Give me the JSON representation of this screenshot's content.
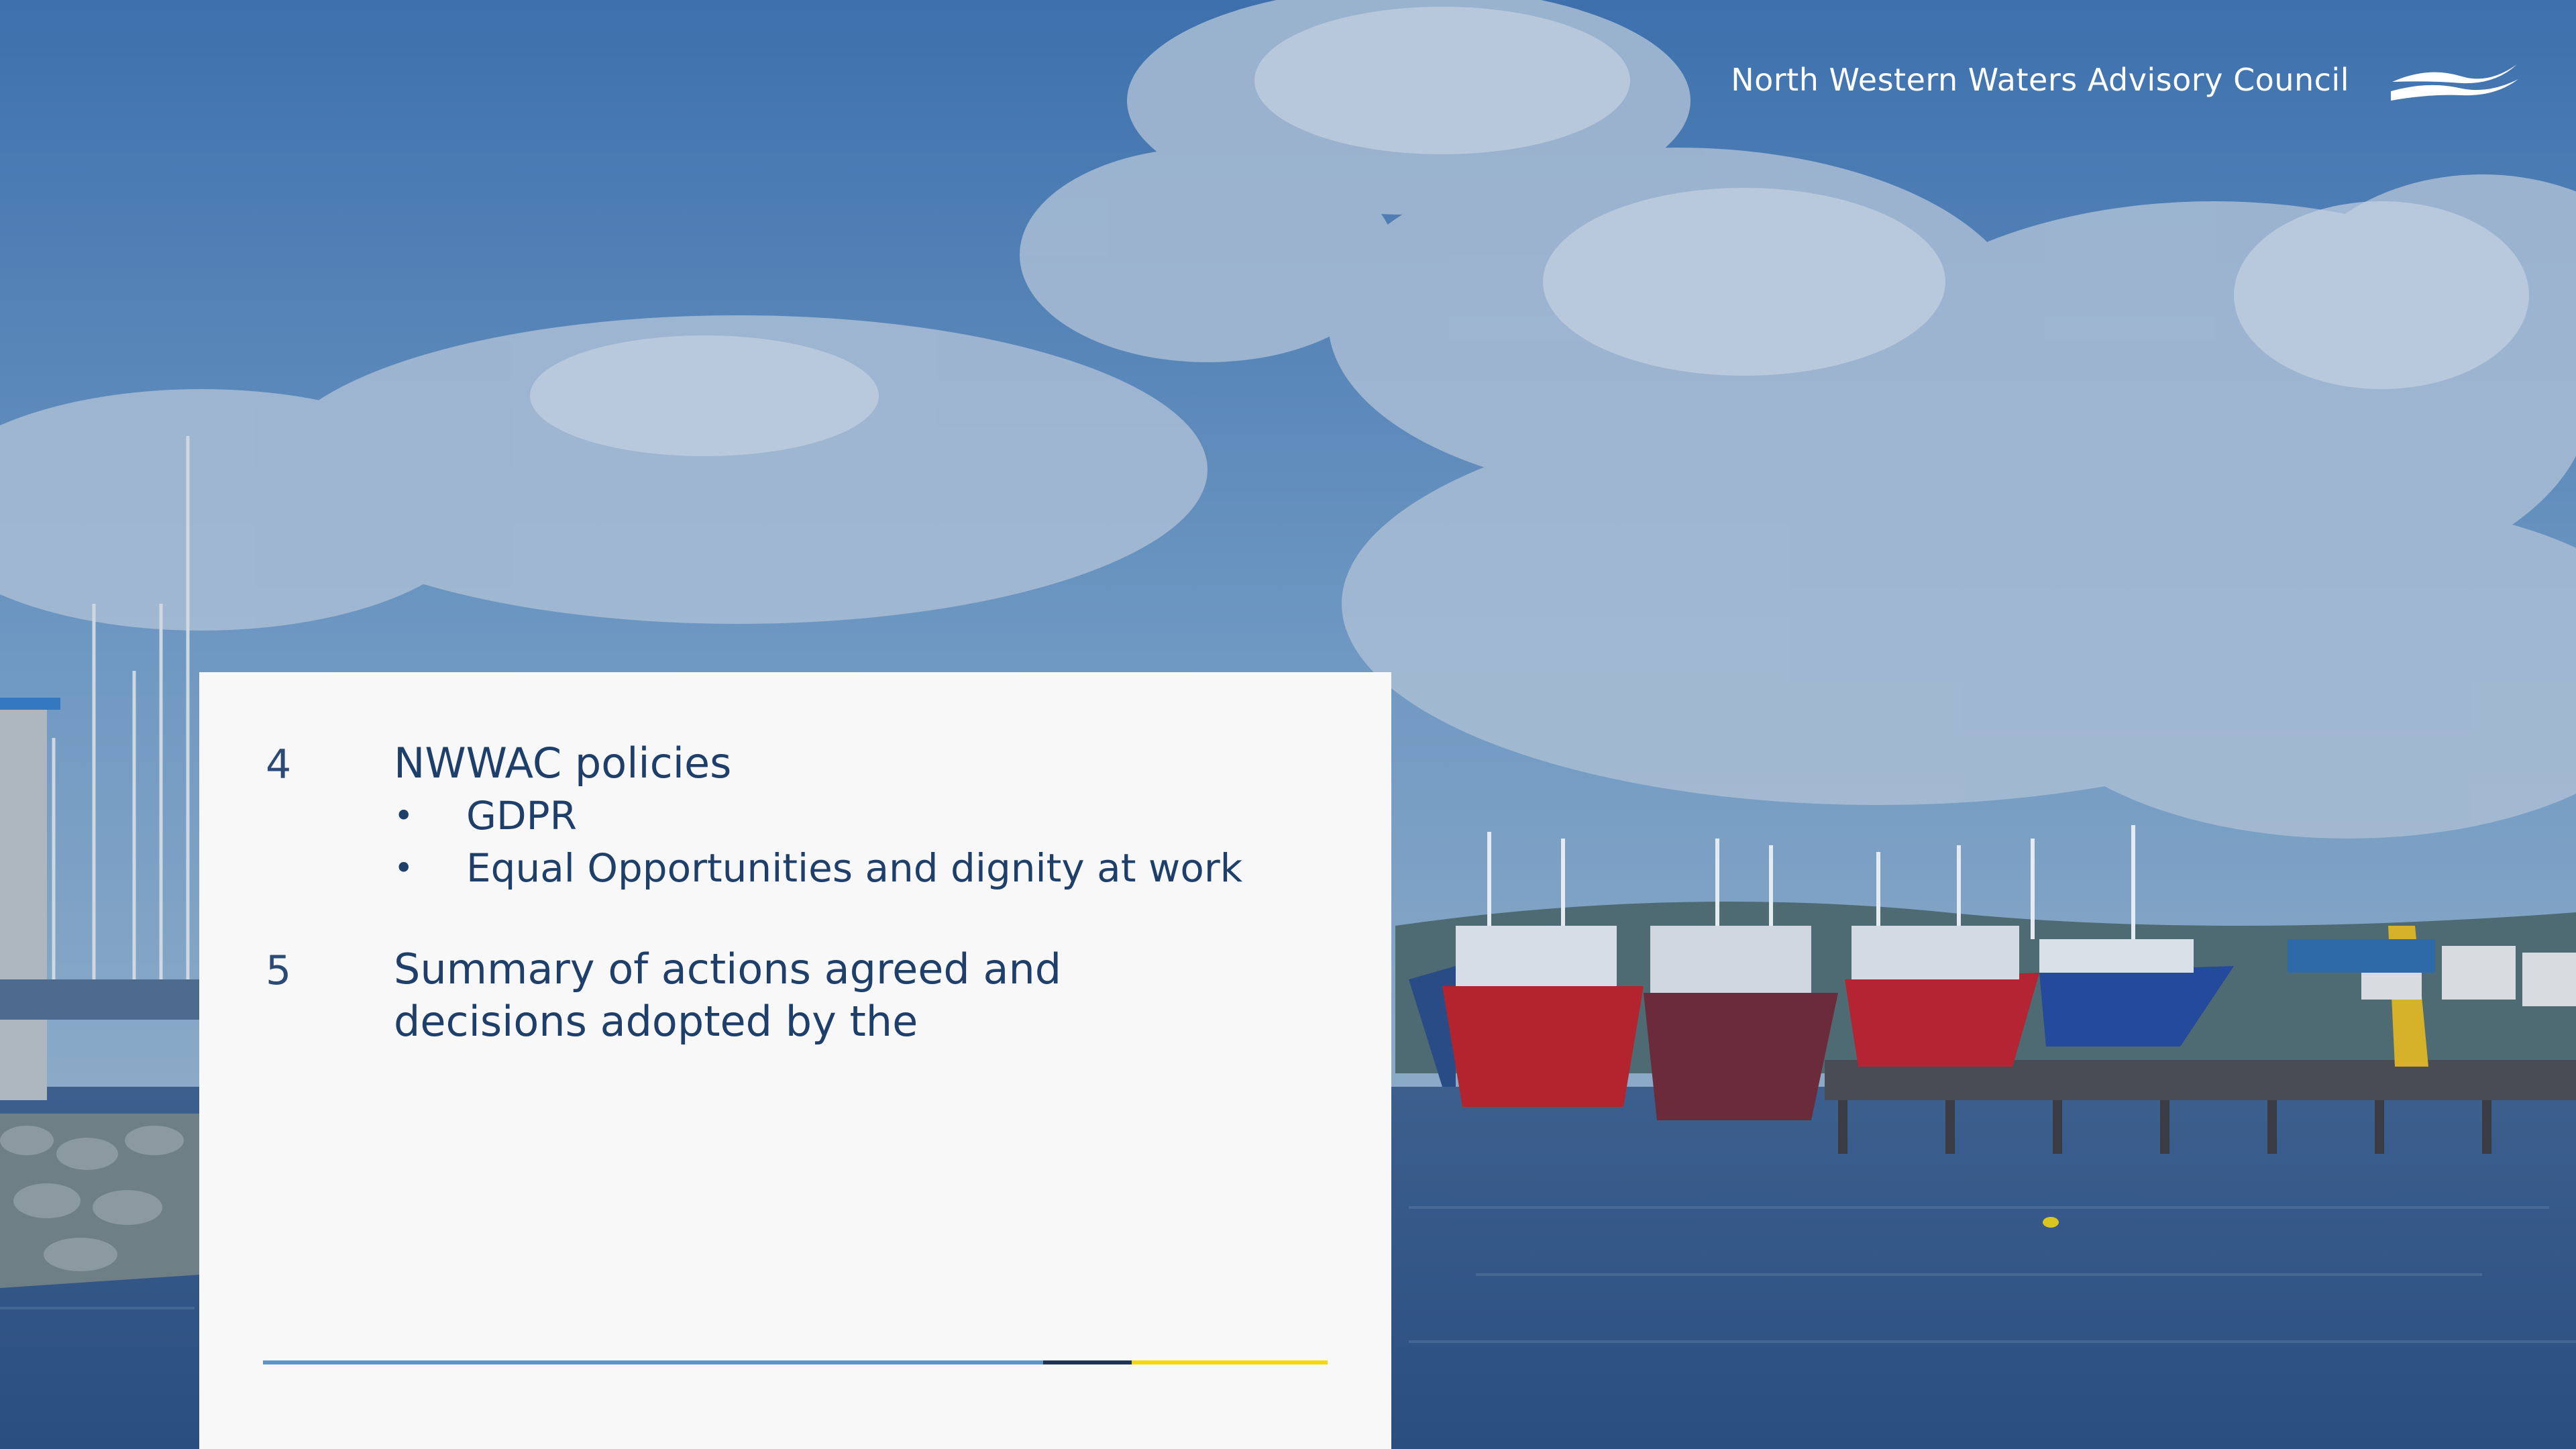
{
  "header": {
    "org_name": "North Western Waters Advisory Council",
    "logo_icon": "waves-logo-icon"
  },
  "agenda": [
    {
      "number": "4",
      "title": "NWWAC policies",
      "bullets": [
        "GDPR",
        "Equal Opportunities and dignity at work"
      ]
    },
    {
      "number": "5",
      "title": "Summary of actions agreed and decisions adopted by the",
      "bullets": []
    }
  ],
  "colors": {
    "text": "#1f3f6b",
    "divider_blue": "#5b95c8",
    "divider_navy": "#1d3457",
    "divider_yellow": "#f5d800",
    "card": "#f8f8f8"
  }
}
